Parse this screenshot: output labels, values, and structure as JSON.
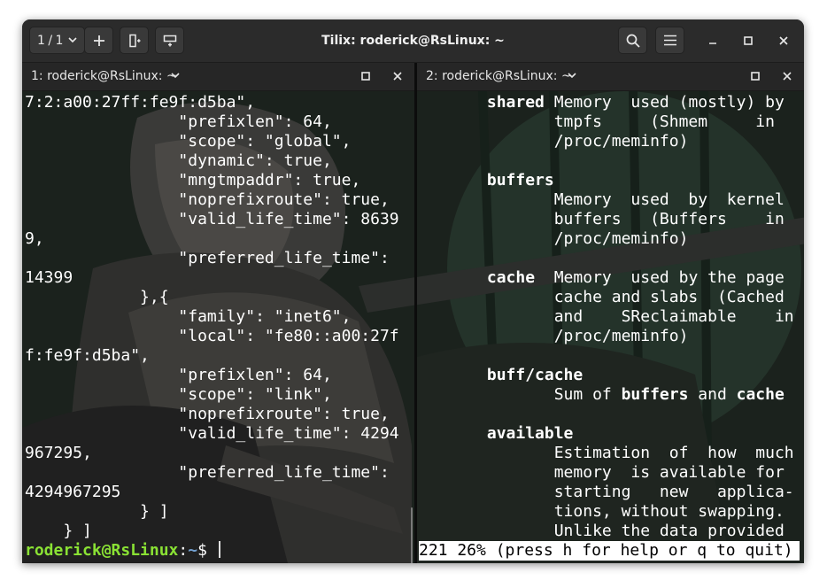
{
  "window": {
    "title": "Tilix: roderick@RsLinux: ~",
    "session_label": "1 / 1"
  },
  "colors": {
    "prompt_user": "#8ae234",
    "prompt_path": "#729fcf"
  },
  "left_pane": {
    "title": "1: roderick@RsLinux: ~",
    "lines": [
      "7:2:a00:27ff:fe9f:d5ba\",",
      "                \"prefixlen\": 64,",
      "                \"scope\": \"global\",",
      "                \"dynamic\": true,",
      "                \"mngtmpaddr\": true,",
      "                \"noprefixroute\": true,",
      "                \"valid_life_time\": 8639",
      "9,",
      "                \"preferred_life_time\":",
      "14399",
      "            },{",
      "                \"family\": \"inet6\",",
      "                \"local\": \"fe80::a00:27f",
      "f:fe9f:d5ba\",",
      "                \"prefixlen\": 64,",
      "                \"scope\": \"link\",",
      "                \"noprefixroute\": true,",
      "                \"valid_life_time\": 4294",
      "967295,",
      "                \"preferred_life_time\":",
      "4294967295",
      "            } ]",
      "    } ]"
    ],
    "prompt": {
      "user_host": "roderick@RsLinux",
      "colon": ":",
      "path": "~",
      "symbol": "$ "
    }
  },
  "right_pane": {
    "title": "2: roderick@RsLinux: ~",
    "lines": [
      [
        {
          "t": "       "
        },
        {
          "t": "shared",
          "b": true
        },
        {
          "t": " Memory  used (mostly) by"
        }
      ],
      [
        {
          "t": "              tmpfs     (Shmem     in"
        }
      ],
      [
        {
          "t": "              /proc/meminfo)"
        }
      ],
      [
        {
          "t": ""
        }
      ],
      [
        {
          "t": "       "
        },
        {
          "t": "buffers",
          "b": true
        }
      ],
      [
        {
          "t": "              Memory  used  by  kernel"
        }
      ],
      [
        {
          "t": "              buffers   (Buffers    in"
        }
      ],
      [
        {
          "t": "              /proc/meminfo)"
        }
      ],
      [
        {
          "t": ""
        }
      ],
      [
        {
          "t": "       "
        },
        {
          "t": "cache",
          "b": true
        },
        {
          "t": "  Memory  used by the page"
        }
      ],
      [
        {
          "t": "              cache and slabs  (Cached"
        }
      ],
      [
        {
          "t": "              and    SReclaimable    in"
        }
      ],
      [
        {
          "t": "              /proc/meminfo)"
        }
      ],
      [
        {
          "t": ""
        }
      ],
      [
        {
          "t": "       "
        },
        {
          "t": "buff/cache",
          "b": true
        }
      ],
      [
        {
          "t": "              Sum of "
        },
        {
          "t": "buffers",
          "b": true
        },
        {
          "t": " and "
        },
        {
          "t": "cache",
          "b": true
        }
      ],
      [
        {
          "t": ""
        }
      ],
      [
        {
          "t": "       "
        },
        {
          "t": "available",
          "b": true
        }
      ],
      [
        {
          "t": "              Estimation  of  how  much"
        }
      ],
      [
        {
          "t": "              memory  is available for"
        }
      ],
      [
        {
          "t": "              starting   new   applica-"
        }
      ],
      [
        {
          "t": "              tions, without swapping."
        }
      ],
      [
        {
          "t": "              Unlike the data provided"
        }
      ]
    ],
    "status": "221 26% (press h for help or q to quit)"
  }
}
